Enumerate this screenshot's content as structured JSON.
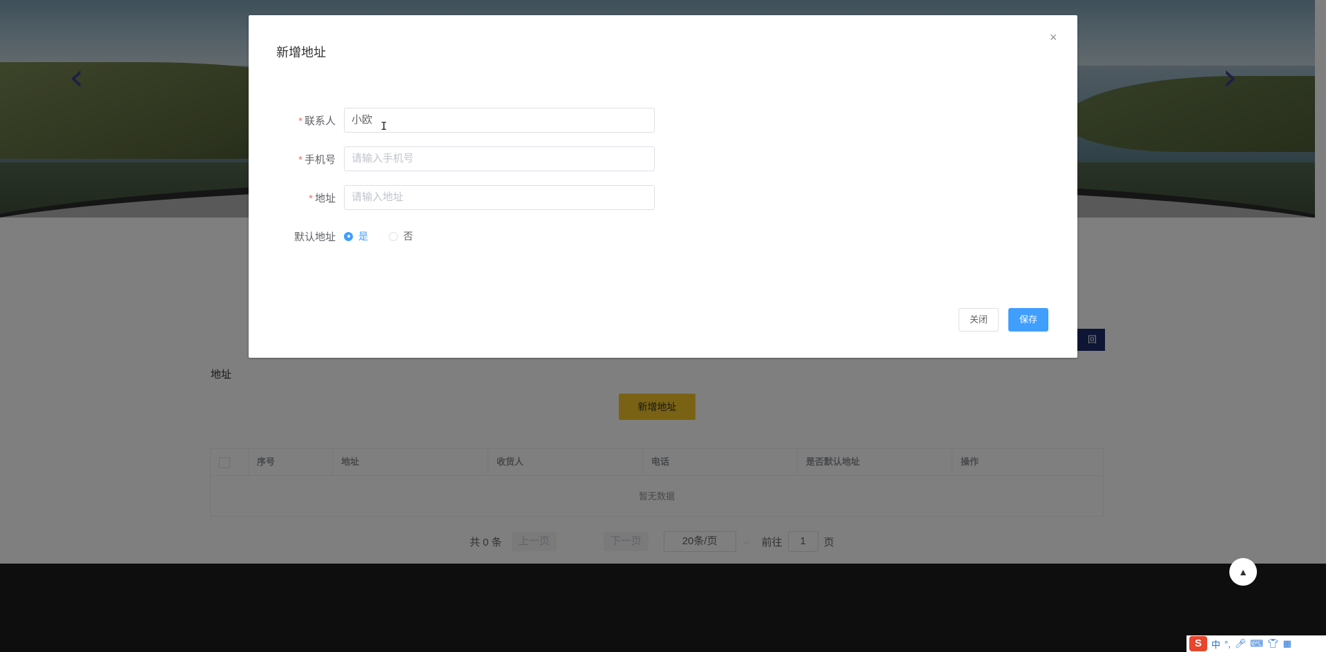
{
  "page": {
    "back_label": "回",
    "address_title": "地址",
    "add_address_button": "新增地址",
    "table": {
      "columns": [
        "序号",
        "地址",
        "收货人",
        "电话",
        "是否默认地址",
        "操作"
      ],
      "empty_text": "暂无数据"
    },
    "pagination": {
      "total": "共 0 条",
      "prev": "上一页",
      "next": "下一页",
      "page_size": "20条/页",
      "goto_label": "前往",
      "current_page": "1",
      "page_suffix": "页"
    }
  },
  "dialog": {
    "title": "新增地址",
    "close_icon": "×",
    "fields": {
      "contact": {
        "label": "联系人",
        "value": "小欧",
        "required": true
      },
      "phone": {
        "label": "手机号",
        "placeholder": "请输入手机号",
        "required": true
      },
      "address": {
        "label": "地址",
        "placeholder": "请输入地址",
        "required": true
      },
      "default": {
        "label": "默认地址",
        "options": [
          "是",
          "否"
        ],
        "selected": "是"
      }
    },
    "buttons": {
      "close": "关闭",
      "save": "保存"
    }
  },
  "ime": {
    "logo": "S",
    "lang": "中"
  },
  "colors": {
    "primary": "#409eff",
    "accent_yellow": "#f2c529",
    "required": "#f56c6c",
    "navy": "#1f2a6b"
  }
}
